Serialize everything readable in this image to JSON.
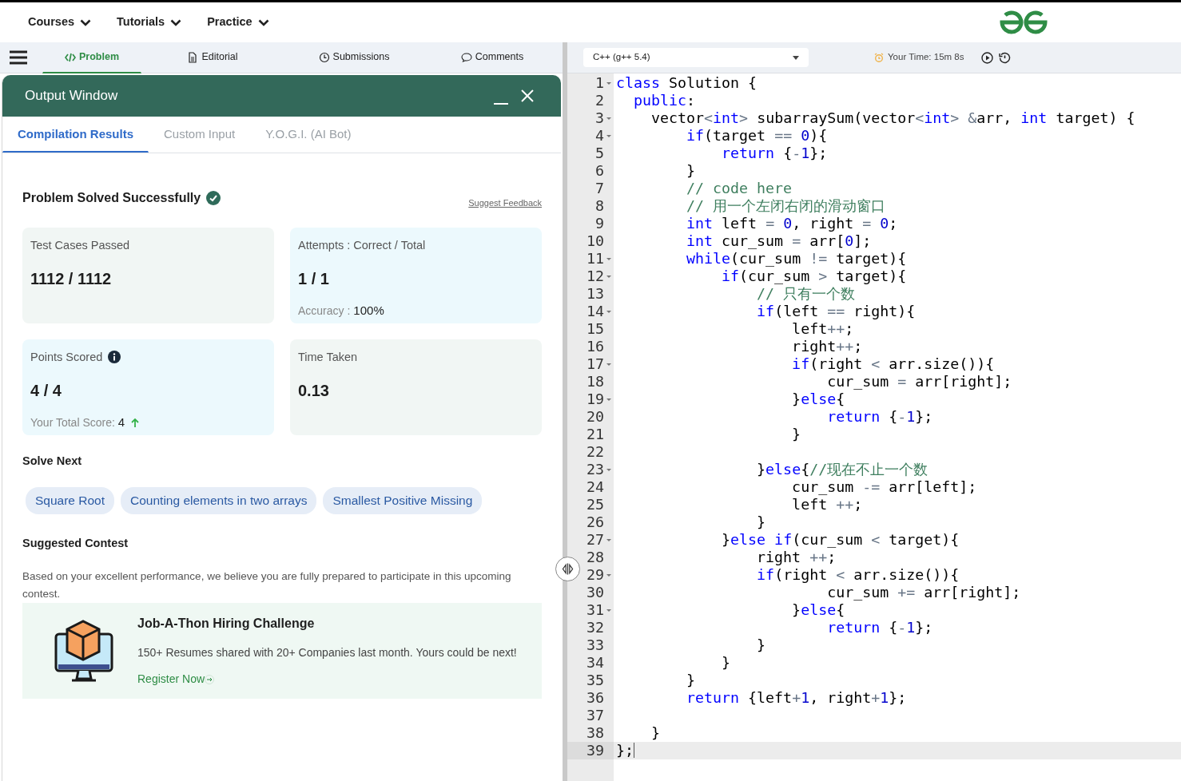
{
  "top_nav": [
    {
      "label": "Courses"
    },
    {
      "label": "Tutorials"
    },
    {
      "label": "Practice"
    }
  ],
  "problem_tabs": [
    {
      "label": "Problem",
      "selected": true,
      "kind": "code"
    },
    {
      "label": "Editorial",
      "selected": false,
      "kind": "doc"
    },
    {
      "label": "Submissions",
      "selected": false,
      "kind": "clock"
    },
    {
      "label": "Comments",
      "selected": false,
      "kind": "chat"
    }
  ],
  "output_window": {
    "title": "Output Window",
    "tabs": [
      {
        "label": "Compilation Results",
        "selected": true
      },
      {
        "label": "Custom Input",
        "selected": false
      },
      {
        "label": "Y.O.G.I. (AI Bot)",
        "selected": false
      }
    ],
    "status": "Problem Solved Successfully",
    "feedback_link": "Suggest Feedback",
    "stats": [
      {
        "label": "Test Cases Passed",
        "value": "1112 / 1112",
        "color": "#f1f6f4"
      },
      {
        "label": "Attempts : Correct / Total",
        "value": "1 / 1",
        "color": "#ecf9fd",
        "sub_label": "Accuracy :",
        "sub_value": "100%"
      },
      {
        "label": "Points Scored",
        "value": "4 / 4",
        "color": "#ecf9fd",
        "info": true,
        "sub_label": "Your Total Score:",
        "sub_value": "4",
        "rising": true
      },
      {
        "label": "Time Taken",
        "value": "0.13",
        "color": "#f1f6f4"
      }
    ]
  },
  "solve_next": {
    "heading": "Solve Next",
    "items": [
      "Square Root",
      "Counting elements in two arrays",
      "Smallest Positive Missing"
    ]
  },
  "suggested_contest": {
    "heading": "Suggested Contest",
    "text": "Based on your excellent performance, we believe you are fully prepared to participate in this upcoming contest.",
    "card": {
      "title": "Job-A-Thon Hiring Challenge",
      "description": "150+ Resumes shared with 20+ Companies last month. Yours could be next!",
      "link": "Register Now"
    }
  },
  "editor": {
    "language": "C++ (g++ 5.4)",
    "timer": "Your Time: 15m 8s",
    "lines": [
      {
        "number": "1",
        "fold": true,
        "active": false,
        "tokens": [
          {
            "text": "class",
            "kind": "kw"
          },
          {
            "text": " Solution {",
            "kind": "tx"
          }
        ]
      },
      {
        "number": "2",
        "fold": false,
        "active": false,
        "tokens": [
          {
            "text": "  public",
            "kind": "kw"
          },
          {
            "text": ":",
            "kind": "tx"
          }
        ]
      },
      {
        "number": "3",
        "fold": true,
        "active": false,
        "tokens": [
          {
            "text": "    vector",
            "kind": "tx"
          },
          {
            "text": "<",
            "kind": "op"
          },
          {
            "text": "int",
            "kind": "kw"
          },
          {
            "text": ">",
            "kind": "op"
          },
          {
            "text": " subarraySum(vector",
            "kind": "tx"
          },
          {
            "text": "<",
            "kind": "op"
          },
          {
            "text": "int",
            "kind": "kw"
          },
          {
            "text": "> &",
            "kind": "op"
          },
          {
            "text": "arr, ",
            "kind": "tx"
          },
          {
            "text": "int",
            "kind": "kw"
          },
          {
            "text": " target) {",
            "kind": "tx"
          }
        ]
      },
      {
        "number": "4",
        "fold": true,
        "active": false,
        "tokens": [
          {
            "text": "        if",
            "kind": "kw"
          },
          {
            "text": "(target ",
            "kind": "tx"
          },
          {
            "text": "== ",
            "kind": "op"
          },
          {
            "text": "0",
            "kind": "num"
          },
          {
            "text": "){",
            "kind": "tx"
          }
        ]
      },
      {
        "number": "5",
        "fold": false,
        "active": false,
        "tokens": [
          {
            "text": "            return",
            "kind": "kw"
          },
          {
            "text": " {",
            "kind": "tx"
          },
          {
            "text": "-",
            "kind": "op"
          },
          {
            "text": "1",
            "kind": "num"
          },
          {
            "text": "};",
            "kind": "tx"
          }
        ]
      },
      {
        "number": "6",
        "fold": false,
        "active": false,
        "tokens": [
          {
            "text": "        }",
            "kind": "tx"
          }
        ]
      },
      {
        "number": "7",
        "fold": false,
        "active": false,
        "tokens": [
          {
            "text": "        // code here",
            "kind": "cm"
          }
        ]
      },
      {
        "number": "8",
        "fold": false,
        "active": false,
        "tokens": [
          {
            "text": "        // 用一个左闭右闭的滑动窗口",
            "kind": "cm"
          }
        ]
      },
      {
        "number": "9",
        "fold": false,
        "active": false,
        "tokens": [
          {
            "text": "        int",
            "kind": "kw"
          },
          {
            "text": " left ",
            "kind": "tx"
          },
          {
            "text": "= ",
            "kind": "op"
          },
          {
            "text": "0",
            "kind": "num"
          },
          {
            "text": ", right ",
            "kind": "tx"
          },
          {
            "text": "= ",
            "kind": "op"
          },
          {
            "text": "0",
            "kind": "num"
          },
          {
            "text": ";",
            "kind": "tx"
          }
        ]
      },
      {
        "number": "10",
        "fold": false,
        "active": false,
        "tokens": [
          {
            "text": "        int",
            "kind": "kw"
          },
          {
            "text": " cur_sum ",
            "kind": "tx"
          },
          {
            "text": "=",
            "kind": "op"
          },
          {
            "text": " arr[",
            "kind": "tx"
          },
          {
            "text": "0",
            "kind": "num"
          },
          {
            "text": "];",
            "kind": "tx"
          }
        ]
      },
      {
        "number": "11",
        "fold": true,
        "active": false,
        "tokens": [
          {
            "text": "        while",
            "kind": "kw"
          },
          {
            "text": "(cur_sum ",
            "kind": "tx"
          },
          {
            "text": "!=",
            "kind": "op"
          },
          {
            "text": " target){",
            "kind": "tx"
          }
        ]
      },
      {
        "number": "12",
        "fold": true,
        "active": false,
        "tokens": [
          {
            "text": "            if",
            "kind": "kw"
          },
          {
            "text": "(cur_sum ",
            "kind": "tx"
          },
          {
            "text": ">",
            "kind": "op"
          },
          {
            "text": " target){",
            "kind": "tx"
          }
        ]
      },
      {
        "number": "13",
        "fold": false,
        "active": false,
        "tokens": [
          {
            "text": "                // 只有一个数",
            "kind": "cm"
          }
        ]
      },
      {
        "number": "14",
        "fold": true,
        "active": false,
        "tokens": [
          {
            "text": "                if",
            "kind": "kw"
          },
          {
            "text": "(left ",
            "kind": "tx"
          },
          {
            "text": "==",
            "kind": "op"
          },
          {
            "text": " right){",
            "kind": "tx"
          }
        ]
      },
      {
        "number": "15",
        "fold": false,
        "active": false,
        "tokens": [
          {
            "text": "                    left",
            "kind": "tx"
          },
          {
            "text": "++",
            "kind": "op"
          },
          {
            "text": ";",
            "kind": "tx"
          }
        ]
      },
      {
        "number": "16",
        "fold": false,
        "active": false,
        "tokens": [
          {
            "text": "                    right",
            "kind": "tx"
          },
          {
            "text": "++",
            "kind": "op"
          },
          {
            "text": ";",
            "kind": "tx"
          }
        ]
      },
      {
        "number": "17",
        "fold": true,
        "active": false,
        "tokens": [
          {
            "text": "                    if",
            "kind": "kw"
          },
          {
            "text": "(right ",
            "kind": "tx"
          },
          {
            "text": "<",
            "kind": "op"
          },
          {
            "text": " arr.size()){",
            "kind": "tx"
          }
        ]
      },
      {
        "number": "18",
        "fold": false,
        "active": false,
        "tokens": [
          {
            "text": "                        cur_sum ",
            "kind": "tx"
          },
          {
            "text": "=",
            "kind": "op"
          },
          {
            "text": " arr[right];",
            "kind": "tx"
          }
        ]
      },
      {
        "number": "19",
        "fold": true,
        "active": false,
        "tokens": [
          {
            "text": "                    }",
            "kind": "tx"
          },
          {
            "text": "else",
            "kind": "kw"
          },
          {
            "text": "{",
            "kind": "tx"
          }
        ]
      },
      {
        "number": "20",
        "fold": false,
        "active": false,
        "tokens": [
          {
            "text": "                        return",
            "kind": "kw"
          },
          {
            "text": " {",
            "kind": "tx"
          },
          {
            "text": "-",
            "kind": "op"
          },
          {
            "text": "1",
            "kind": "num"
          },
          {
            "text": "};",
            "kind": "tx"
          }
        ]
      },
      {
        "number": "21",
        "fold": false,
        "active": false,
        "tokens": [
          {
            "text": "                    }",
            "kind": "tx"
          }
        ]
      },
      {
        "number": "22",
        "fold": false,
        "active": false
      },
      {
        "number": "23",
        "fold": true,
        "active": false,
        "tokens": [
          {
            "text": "                }",
            "kind": "tx"
          },
          {
            "text": "else",
            "kind": "kw"
          },
          {
            "text": "{",
            "kind": "tx"
          },
          {
            "text": "//现在不止一个数",
            "kind": "cm"
          }
        ]
      },
      {
        "number": "24",
        "fold": false,
        "active": false,
        "tokens": [
          {
            "text": "                    cur_sum ",
            "kind": "tx"
          },
          {
            "text": "-=",
            "kind": "op"
          },
          {
            "text": " arr[left];",
            "kind": "tx"
          }
        ]
      },
      {
        "number": "25",
        "fold": false,
        "active": false,
        "tokens": [
          {
            "text": "                    left ",
            "kind": "tx"
          },
          {
            "text": "++",
            "kind": "op"
          },
          {
            "text": ";",
            "kind": "tx"
          }
        ]
      },
      {
        "number": "26",
        "fold": false,
        "active": false,
        "tokens": [
          {
            "text": "                }",
            "kind": "tx"
          }
        ]
      },
      {
        "number": "27",
        "fold": true,
        "active": false,
        "tokens": [
          {
            "text": "            }",
            "kind": "tx"
          },
          {
            "text": "else if",
            "kind": "kw"
          },
          {
            "text": "(cur_sum ",
            "kind": "tx"
          },
          {
            "text": "<",
            "kind": "op"
          },
          {
            "text": " target){",
            "kind": "tx"
          }
        ]
      },
      {
        "number": "28",
        "fold": false,
        "active": false,
        "tokens": [
          {
            "text": "                right ",
            "kind": "tx"
          },
          {
            "text": "++",
            "kind": "op"
          },
          {
            "text": ";",
            "kind": "tx"
          }
        ]
      },
      {
        "number": "29",
        "fold": true,
        "active": false,
        "tokens": [
          {
            "text": "                if",
            "kind": "kw"
          },
          {
            "text": "(right ",
            "kind": "tx"
          },
          {
            "text": "<",
            "kind": "op"
          },
          {
            "text": " arr.size()){",
            "kind": "tx"
          }
        ]
      },
      {
        "number": "30",
        "fold": false,
        "active": false,
        "tokens": [
          {
            "text": "                        cur_sum ",
            "kind": "tx"
          },
          {
            "text": "+=",
            "kind": "op"
          },
          {
            "text": " arr[right];",
            "kind": "tx"
          }
        ]
      },
      {
        "number": "31",
        "fold": true,
        "active": false,
        "tokens": [
          {
            "text": "                    }",
            "kind": "tx"
          },
          {
            "text": "else",
            "kind": "kw"
          },
          {
            "text": "{",
            "kind": "tx"
          }
        ]
      },
      {
        "number": "32",
        "fold": false,
        "active": false,
        "tokens": [
          {
            "text": "                        return",
            "kind": "kw"
          },
          {
            "text": " {",
            "kind": "tx"
          },
          {
            "text": "-",
            "kind": "op"
          },
          {
            "text": "1",
            "kind": "num"
          },
          {
            "text": "};",
            "kind": "tx"
          }
        ]
      },
      {
        "number": "33",
        "fold": false,
        "active": false,
        "tokens": [
          {
            "text": "                }",
            "kind": "tx"
          }
        ]
      },
      {
        "number": "34",
        "fold": false,
        "active": false,
        "tokens": [
          {
            "text": "            }",
            "kind": "tx"
          }
        ]
      },
      {
        "number": "35",
        "fold": false,
        "active": false,
        "tokens": [
          {
            "text": "        }",
            "kind": "tx"
          }
        ]
      },
      {
        "number": "36",
        "fold": false,
        "active": false,
        "tokens": [
          {
            "text": "        return",
            "kind": "kw"
          },
          {
            "text": " {left",
            "kind": "tx"
          },
          {
            "text": "+",
            "kind": "op"
          },
          {
            "text": "1",
            "kind": "num"
          },
          {
            "text": ", right",
            "kind": "tx"
          },
          {
            "text": "+",
            "kind": "op"
          },
          {
            "text": "1",
            "kind": "num"
          },
          {
            "text": "};",
            "kind": "tx"
          }
        ]
      },
      {
        "number": "37",
        "fold": false,
        "active": false
      },
      {
        "number": "38",
        "fold": false,
        "active": false,
        "tokens": [
          {
            "text": "    }",
            "kind": "tx"
          }
        ]
      },
      {
        "number": "39",
        "fold": false,
        "active": true,
        "tokens": [
          {
            "text": "};",
            "kind": "tx"
          }
        ]
      }
    ]
  }
}
